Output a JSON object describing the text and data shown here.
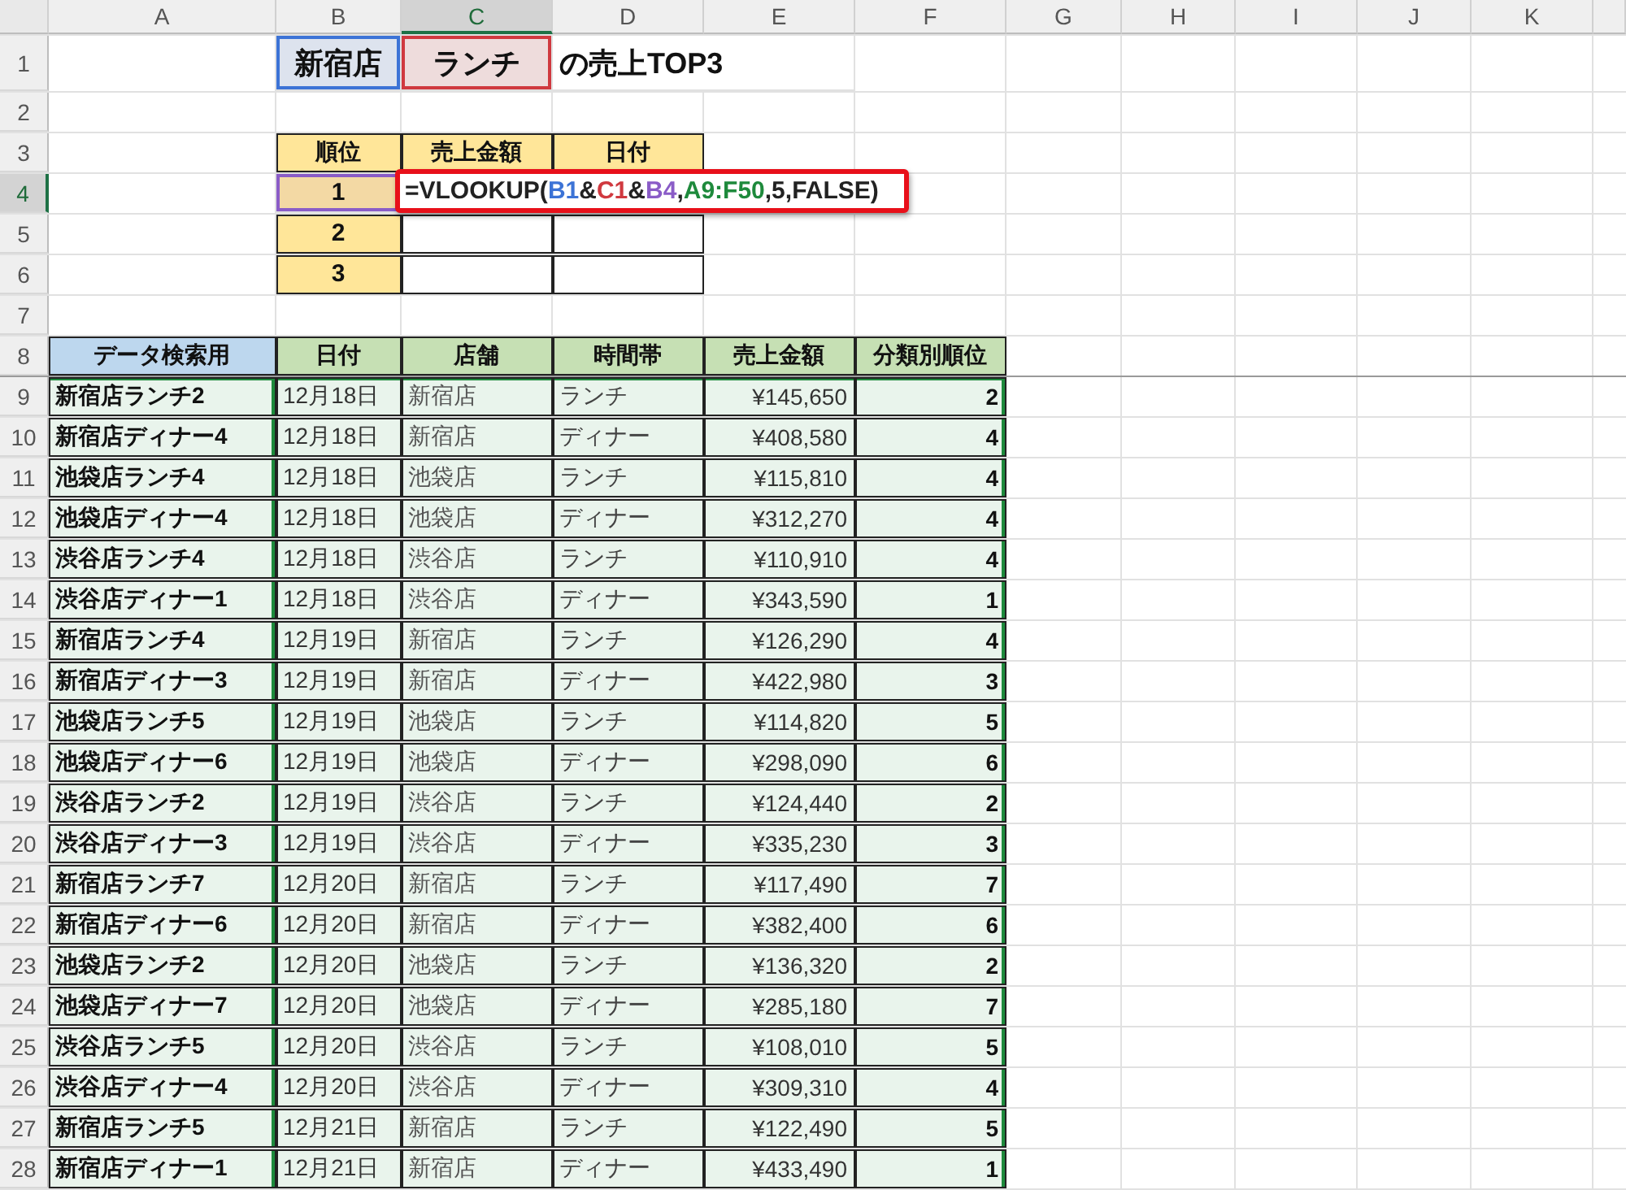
{
  "column_headers": [
    {
      "label": "A",
      "selected": false
    },
    {
      "label": "B",
      "selected": false
    },
    {
      "label": "C",
      "selected": true
    },
    {
      "label": "D",
      "selected": false
    },
    {
      "label": "E",
      "selected": false
    },
    {
      "label": "F",
      "selected": false
    },
    {
      "label": "G",
      "selected": false
    },
    {
      "label": "H",
      "selected": false
    },
    {
      "label": "I",
      "selected": false
    },
    {
      "label": "J",
      "selected": false
    },
    {
      "label": "K",
      "selected": false
    }
  ],
  "row_numbers": [
    {
      "label": "1",
      "selected": false
    },
    {
      "label": "2",
      "selected": false
    },
    {
      "label": "3",
      "selected": false
    },
    {
      "label": "4",
      "selected": true
    },
    {
      "label": "5",
      "selected": false
    },
    {
      "label": "6",
      "selected": false
    },
    {
      "label": "7",
      "selected": false
    },
    {
      "label": "8",
      "selected": false
    },
    {
      "label": "9",
      "selected": false
    },
    {
      "label": "10",
      "selected": false
    },
    {
      "label": "11",
      "selected": false
    },
    {
      "label": "12",
      "selected": false
    },
    {
      "label": "13",
      "selected": false
    },
    {
      "label": "14",
      "selected": false
    },
    {
      "label": "15",
      "selected": false
    },
    {
      "label": "16",
      "selected": false
    },
    {
      "label": "17",
      "selected": false
    },
    {
      "label": "18",
      "selected": false
    },
    {
      "label": "19",
      "selected": false
    },
    {
      "label": "20",
      "selected": false
    },
    {
      "label": "21",
      "selected": false
    },
    {
      "label": "22",
      "selected": false
    },
    {
      "label": "23",
      "selected": false
    },
    {
      "label": "24",
      "selected": false
    },
    {
      "label": "25",
      "selected": false
    },
    {
      "label": "26",
      "selected": false
    },
    {
      "label": "27",
      "selected": false
    },
    {
      "label": "28",
      "selected": false
    }
  ],
  "title": {
    "store": {
      "text": "新宿店",
      "color": "#3c73d6"
    },
    "timeslot": {
      "text": "ランチ",
      "color": "#d0393f"
    },
    "suffix": "の売上TOP3"
  },
  "top3": {
    "columns": [
      "順位",
      "売上金額",
      "日付"
    ],
    "rows": [
      {
        "rank": "1",
        "selected": true
      },
      {
        "rank": "2",
        "selected": false
      },
      {
        "rank": "3",
        "selected": false
      }
    ]
  },
  "formula": [
    {
      "text": "=VLOOKUP(",
      "color": "#222222"
    },
    {
      "text": "B1",
      "color": "#3c73d6"
    },
    {
      "text": "&",
      "color": "#222222"
    },
    {
      "text": "C1",
      "color": "#d0393f"
    },
    {
      "text": "&",
      "color": "#222222"
    },
    {
      "text": "B4",
      "color": "#8a5cc7"
    },
    {
      "text": ",",
      "color": "#222222"
    },
    {
      "text": "A9:F50",
      "color": "#1e8a3c"
    },
    {
      "text": ",5,FALSE)",
      "color": "#222222"
    }
  ],
  "data_table": {
    "columns": [
      {
        "label": "データ検索用",
        "kind": "key",
        "color": "#bdd7ee"
      },
      {
        "label": "日付",
        "kind": "date",
        "color": "#c6e0b4"
      },
      {
        "label": "店舗",
        "kind": "store",
        "color": "#c6e0b4"
      },
      {
        "label": "時間帯",
        "kind": "text",
        "color": "#c6e0b4"
      },
      {
        "label": "売上金額",
        "kind": "number",
        "color": "#c6e0b4"
      },
      {
        "label": "分類別順位",
        "kind": "rank",
        "color": "#c6e0b4"
      }
    ],
    "rows": [
      [
        "新宿店ランチ2",
        "12月18日",
        "新宿店",
        "ランチ",
        "¥145,650",
        "2"
      ],
      [
        "新宿店ディナー4",
        "12月18日",
        "新宿店",
        "ディナー",
        "¥408,580",
        "4"
      ],
      [
        "池袋店ランチ4",
        "12月18日",
        "池袋店",
        "ランチ",
        "¥115,810",
        "4"
      ],
      [
        "池袋店ディナー4",
        "12月18日",
        "池袋店",
        "ディナー",
        "¥312,270",
        "4"
      ],
      [
        "渋谷店ランチ4",
        "12月18日",
        "渋谷店",
        "ランチ",
        "¥110,910",
        "4"
      ],
      [
        "渋谷店ディナー1",
        "12月18日",
        "渋谷店",
        "ディナー",
        "¥343,590",
        "1"
      ],
      [
        "新宿店ランチ4",
        "12月19日",
        "新宿店",
        "ランチ",
        "¥126,290",
        "4"
      ],
      [
        "新宿店ディナー3",
        "12月19日",
        "新宿店",
        "ディナー",
        "¥422,980",
        "3"
      ],
      [
        "池袋店ランチ5",
        "12月19日",
        "池袋店",
        "ランチ",
        "¥114,820",
        "5"
      ],
      [
        "池袋店ディナー6",
        "12月19日",
        "池袋店",
        "ディナー",
        "¥298,090",
        "6"
      ],
      [
        "渋谷店ランチ2",
        "12月19日",
        "渋谷店",
        "ランチ",
        "¥124,440",
        "2"
      ],
      [
        "渋谷店ディナー3",
        "12月19日",
        "渋谷店",
        "ディナー",
        "¥335,230",
        "3"
      ],
      [
        "新宿店ランチ7",
        "12月20日",
        "新宿店",
        "ランチ",
        "¥117,490",
        "7"
      ],
      [
        "新宿店ディナー6",
        "12月20日",
        "新宿店",
        "ディナー",
        "¥382,400",
        "6"
      ],
      [
        "池袋店ランチ2",
        "12月20日",
        "池袋店",
        "ランチ",
        "¥136,320",
        "2"
      ],
      [
        "池袋店ディナー7",
        "12月20日",
        "池袋店",
        "ディナー",
        "¥285,180",
        "7"
      ],
      [
        "渋谷店ランチ5",
        "12月20日",
        "渋谷店",
        "ランチ",
        "¥108,010",
        "5"
      ],
      [
        "渋谷店ディナー4",
        "12月20日",
        "渋谷店",
        "ディナー",
        "¥309,310",
        "4"
      ],
      [
        "新宿店ランチ5",
        "12月21日",
        "新宿店",
        "ランチ",
        "¥122,490",
        "5"
      ],
      [
        "新宿店ディナー1",
        "12月21日",
        "新宿店",
        "ディナー",
        "¥433,490",
        "1"
      ]
    ]
  }
}
